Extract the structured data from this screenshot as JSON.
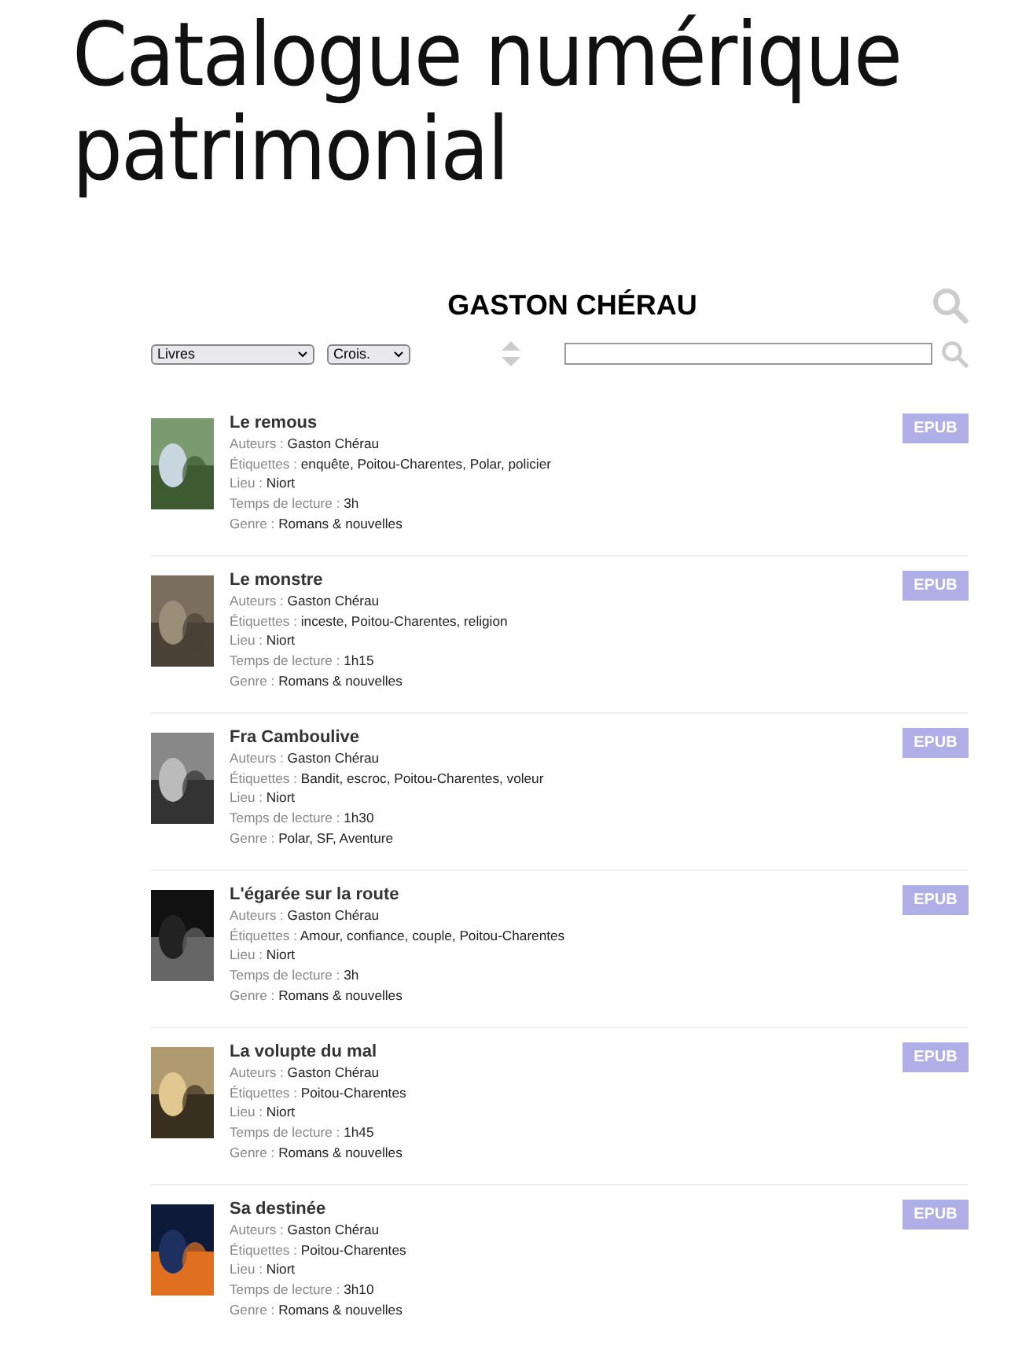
{
  "page_title": "Catalogue numérique patrimonial",
  "author_heading": "GASTON CHÉRAU",
  "filters": {
    "type_select": "Livres",
    "order_select": "Crois."
  },
  "books": [
    {
      "title": "Le remous",
      "fields": [
        {
          "label": "Auteurs :",
          "value": "Gaston Chérau"
        },
        {
          "label": "Étiquettes :",
          "value": "enquête, Poitou-Charentes, Polar, policier"
        },
        {
          "label": "Lieu :",
          "value": "Niort"
        },
        {
          "label": "Temps de lecture :",
          "value": "3h"
        },
        {
          "label": "Genre :",
          "value": "Romans & nouvelles"
        }
      ],
      "format": "EPUB"
    },
    {
      "title": "Le monstre",
      "fields": [
        {
          "label": "Auteurs :",
          "value": "Gaston Chérau"
        },
        {
          "label": "Étiquettes :",
          "value": "inceste, Poitou-Charentes, religion"
        },
        {
          "label": "Lieu :",
          "value": "Niort"
        },
        {
          "label": "Temps de lecture :",
          "value": "1h15"
        },
        {
          "label": "Genre :",
          "value": "Romans & nouvelles"
        }
      ],
      "format": "EPUB"
    },
    {
      "title": "Fra Camboulive",
      "fields": [
        {
          "label": "Auteurs :",
          "value": "Gaston Chérau"
        },
        {
          "label": "Étiquettes :",
          "value": "Bandit, escroc, Poitou-Charentes, voleur"
        },
        {
          "label": "Lieu :",
          "value": "Niort"
        },
        {
          "label": "Temps de lecture :",
          "value": "1h30"
        },
        {
          "label": "Genre :",
          "value": "Polar, SF, Aventure"
        }
      ],
      "format": "EPUB"
    },
    {
      "title": "L'égarée sur la route",
      "fields": [
        {
          "label": "Auteurs :",
          "value": "Gaston Chérau"
        },
        {
          "label": "Étiquettes :",
          "value": "Amour, confiance, couple, Poitou-Charentes"
        },
        {
          "label": "Lieu :",
          "value": "Niort"
        },
        {
          "label": "Temps de lecture :",
          "value": "3h"
        },
        {
          "label": "Genre :",
          "value": "Romans & nouvelles"
        }
      ],
      "format": "EPUB"
    },
    {
      "title": "La volupte du mal",
      "fields": [
        {
          "label": "Auteurs :",
          "value": "Gaston Chérau"
        },
        {
          "label": "Étiquettes :",
          "value": "Poitou-Charentes"
        },
        {
          "label": "Lieu :",
          "value": "Niort"
        },
        {
          "label": "Temps de lecture :",
          "value": "1h45"
        },
        {
          "label": "Genre :",
          "value": "Romans & nouvelles"
        }
      ],
      "format": "EPUB"
    },
    {
      "title": "Sa destinée",
      "fields": [
        {
          "label": "Auteurs :",
          "value": "Gaston Chérau"
        },
        {
          "label": "Étiquettes :",
          "value": "Poitou-Charentes"
        },
        {
          "label": "Lieu :",
          "value": "Niort"
        },
        {
          "label": "Temps de lecture :",
          "value": "3h10"
        },
        {
          "label": "Genre :",
          "value": "Romans & nouvelles"
        }
      ],
      "format": "EPUB"
    }
  ]
}
